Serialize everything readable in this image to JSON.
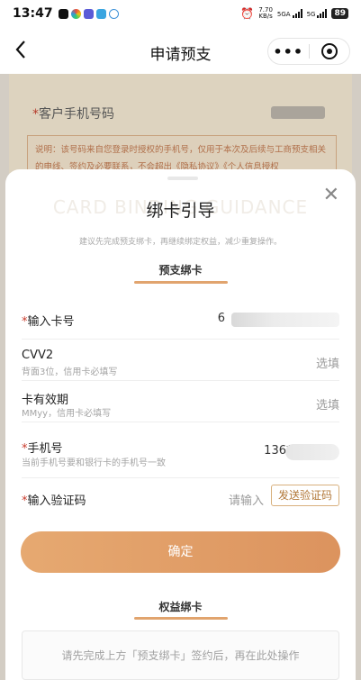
{
  "status_bar": {
    "time": "13:47",
    "net_speed": "7.70",
    "net_unit": "KB/s",
    "sig1": "5GA",
    "sig2": "5G",
    "battery": "89"
  },
  "nav": {
    "title": "申请预支",
    "back_icon": "chevron-left-icon",
    "more_icon": "more-dots-icon",
    "target_icon": "target-icon"
  },
  "background": {
    "phone_label": "客户手机号码",
    "required_mark": "*",
    "notice": "说明：该号码来自您登录时授权的手机号，仅用于本次及后续与工商预支相关的申线、签约及必要联系，不会超出《隐私协议》《个人信息授权"
  },
  "sheet": {
    "watermark": "CARD BINDING GUIDANCE",
    "title": "绑卡引导",
    "subtitle": "建议先完成预支绑卡，再继续绑定权益，减少重复操作。",
    "close_icon": "close-icon",
    "section1": "预支绑卡",
    "section2": "权益绑卡",
    "fields": [
      {
        "label": "输入卡号",
        "required": "*",
        "value": "6"
      },
      {
        "label": "CVV2",
        "hint": "背面3位，信用卡必填写",
        "placeholder": "选填"
      },
      {
        "label": "卡有效期",
        "hint": "MMyy，信用卡必填写",
        "placeholder": "选填"
      },
      {
        "label": "手机号",
        "required": "*",
        "hint": "当前手机号要和银行卡的手机号一致",
        "value": "136**"
      },
      {
        "label": "输入验证码",
        "required": "*",
        "placeholder": "请输入",
        "button": "发送验证码"
      }
    ],
    "confirm": "确定",
    "notice": "请先完成上方「预支绑卡」签约后，再在此处操作"
  },
  "colors": {
    "accent": "#e1a46e",
    "required": "#c83a2b"
  }
}
